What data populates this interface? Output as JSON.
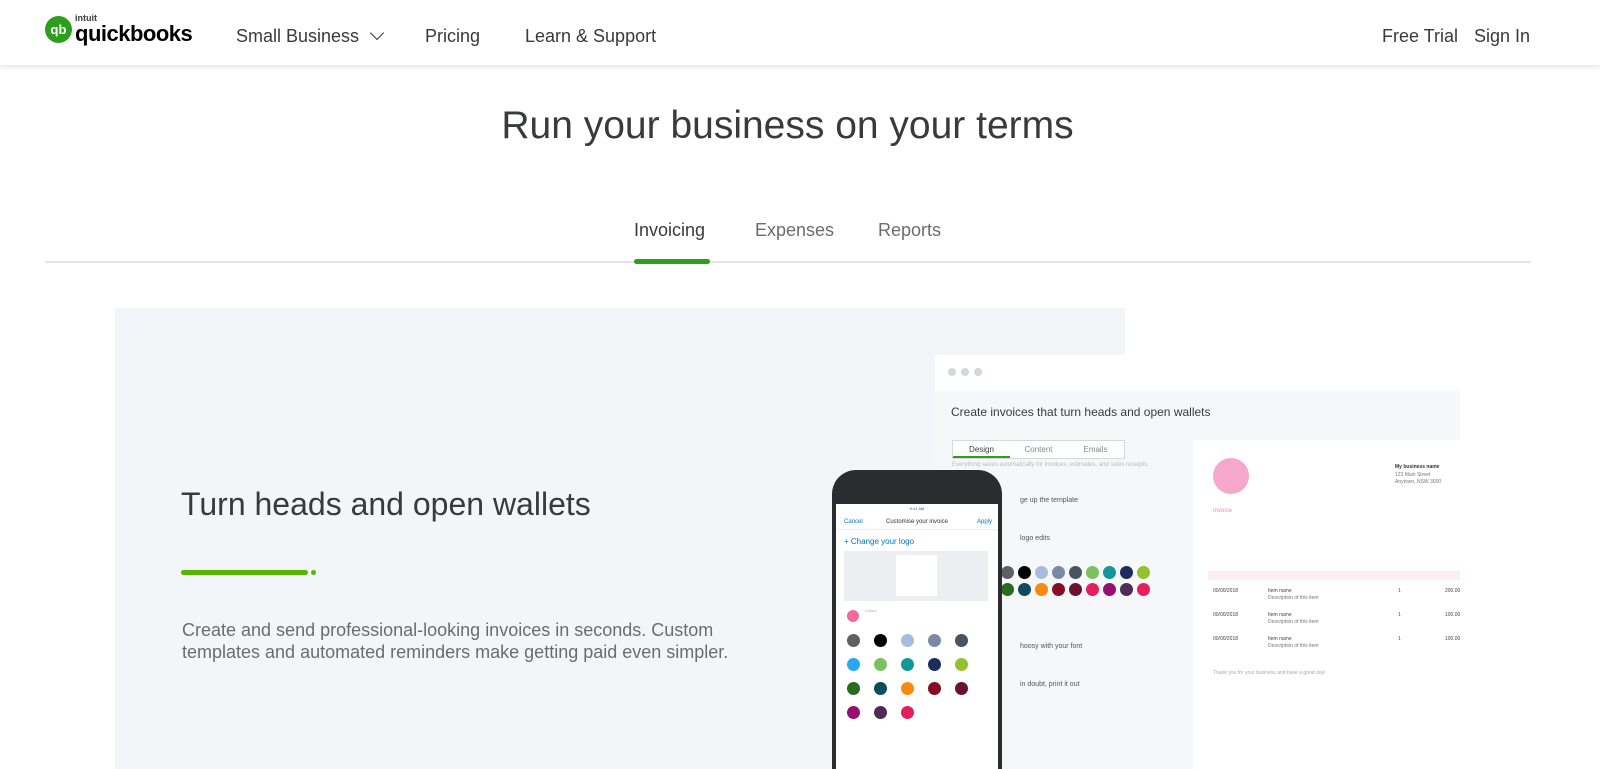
{
  "header": {
    "logo_brand": "intuit",
    "logo_name": "quickbooks",
    "nav": [
      {
        "label": "Small Business",
        "icon": "chevron-down-icon"
      },
      {
        "label": "Pricing"
      },
      {
        "label": "Learn & Support"
      }
    ],
    "free_trial": "Free Trial",
    "sign_in": "Sign In"
  },
  "hero": {
    "title": "Run your business on your terms"
  },
  "tabs": [
    {
      "label": "Invoicing",
      "active": true
    },
    {
      "label": "Expenses"
    },
    {
      "label": "Reports"
    }
  ],
  "feature": {
    "heading": "Turn heads and open wallets",
    "description": "Create and send professional-looking invoices in seconds. Custom templates and automated reminders make getting paid even simpler."
  },
  "mock_window": {
    "title": "Create invoices that turn heads and open wallets",
    "tabs": [
      "Design",
      "Content",
      "Emails"
    ],
    "subtitle": "Everything saves automatically for invoices, estimates, and sales receipts.",
    "steps": [
      "ge up the template",
      "logo edits",
      "hoosy with your font",
      "in doubt, print it out"
    ],
    "invoice": {
      "business": "My business name",
      "address1": "123 Main Street",
      "address2": "Anytown, NSW 3000",
      "label": "Invoice",
      "rows": [
        {
          "date": "00/00/2018",
          "item": "Item name",
          "desc": "Description of this item",
          "qty": "1",
          "amount": "200.00"
        },
        {
          "date": "00/00/2018",
          "item": "Item name",
          "desc": "Description of this item",
          "qty": "1",
          "amount": "100.00"
        },
        {
          "date": "00/00/2018",
          "item": "Item name",
          "desc": "Description of this item",
          "qty": "1",
          "amount": "100.00"
        }
      ],
      "thanks": "Thank you for your business and have a great day!"
    }
  },
  "phone": {
    "time": "9:41 AM",
    "cancel": "Cancel",
    "title": "Customise your invoice",
    "apply": "Apply",
    "change_logo": "+ Change your logo",
    "colour_label": "Colour"
  },
  "colors": {
    "brand_green": "#2ca01c",
    "accent_green": "#53b700",
    "swatches": [
      "#5f6063",
      "#000000",
      "#a6bddb",
      "#7a8aa3",
      "#4a545e",
      "#2aa7f0",
      "#7bc15d",
      "#14979b",
      "#1d2c5e",
      "#94c12e",
      "#2a6b1e",
      "#0d4c5a",
      "#f68b0f",
      "#860d25",
      "#6b1231",
      "#950f71",
      "#512b55",
      "#e51f5c"
    ]
  }
}
